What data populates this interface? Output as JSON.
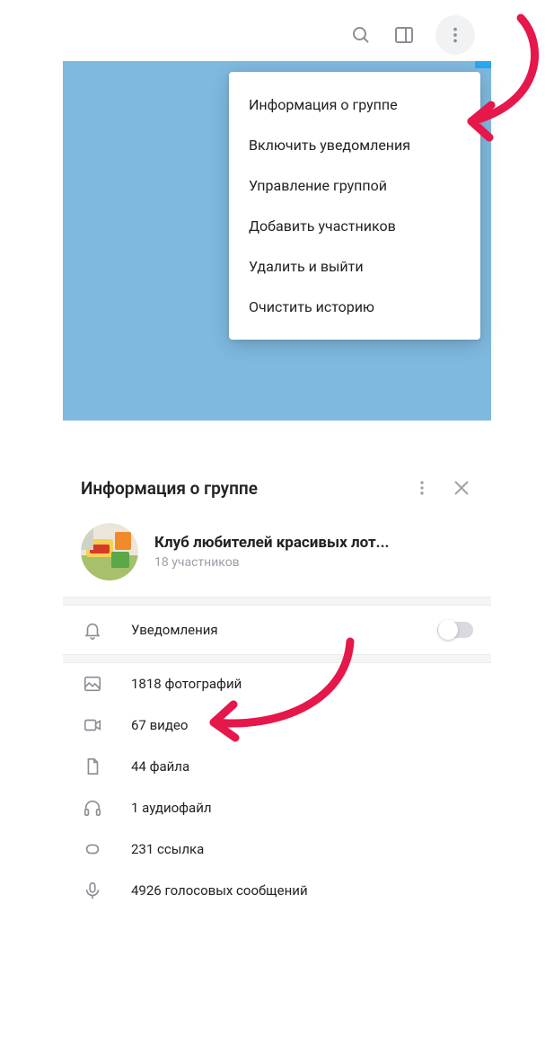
{
  "menu": {
    "items": [
      "Информация о группе",
      "Включить  уведомления",
      "Управление группой",
      "Добавить участников",
      "Удалить и выйти",
      "Очистить историю"
    ]
  },
  "info": {
    "header_title": "Информация о группе",
    "group_name": "Клуб любителей красивых лот...",
    "group_subtitle": "18 участников",
    "notifications_label": "Уведомления",
    "notifications_on": false,
    "media": {
      "photos": "1818 фотографий",
      "videos": "67 видео",
      "files": "44 файла",
      "audio": "1 аудиофайл",
      "links": "231 ссылка",
      "voice": "4926 голосовых сообщений"
    }
  },
  "colors": {
    "accent_blue": "#7fb9df",
    "arrow": "#e6174a"
  }
}
